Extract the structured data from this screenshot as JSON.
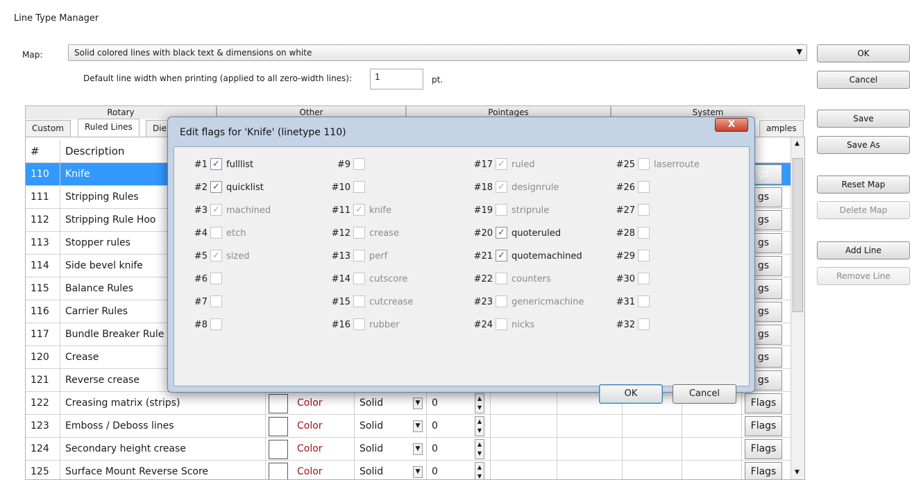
{
  "window": {
    "title": "Line Type Manager"
  },
  "map": {
    "label": "Map:",
    "value": "Solid colored lines with black text & dimensions on white",
    "default_width_label": "Default line width when printing (applied to all zero-width lines):",
    "default_width_value": "1",
    "unit": "pt."
  },
  "side_buttons": {
    "ok": "OK",
    "cancel": "Cancel",
    "save": "Save",
    "save_as": "Save As",
    "reset_map": "Reset Map",
    "delete_map": "Delete Map",
    "add_line": "Add Line",
    "remove_line": "Remove Line"
  },
  "group_tabs": [
    "Rotary",
    "Other",
    "Pointages",
    "System"
  ],
  "sub_tabs": {
    "custom": "Custom",
    "ruled": "Ruled Lines",
    "die": "Die",
    "samples": "amples"
  },
  "table": {
    "headers": {
      "num": "#",
      "desc": "Description",
      "flags": "gs"
    },
    "rows": [
      {
        "num": "110",
        "desc": "Knife",
        "flags": "gs"
      },
      {
        "num": "111",
        "desc": "Stripping Rules",
        "flags": "gs"
      },
      {
        "num": "112",
        "desc": "Stripping Rule Hoo",
        "flags": "gs"
      },
      {
        "num": "113",
        "desc": "Stopper rules",
        "flags": "gs"
      },
      {
        "num": "114",
        "desc": "Side bevel knife",
        "flags": "gs"
      },
      {
        "num": "115",
        "desc": "Balance Rules",
        "flags": "gs"
      },
      {
        "num": "116",
        "desc": "Carrier Rules",
        "flags": "gs"
      },
      {
        "num": "117",
        "desc": "Bundle Breaker Rule",
        "flags": "gs"
      },
      {
        "num": "120",
        "desc": "Crease",
        "flags": "gs"
      },
      {
        "num": "121",
        "desc": "Reverse crease",
        "flags": "gs"
      },
      {
        "num": "122",
        "desc": "Creasing matrix (strips)",
        "color": "Color",
        "style": "Solid",
        "width": "0",
        "flags": "Flags"
      },
      {
        "num": "123",
        "desc": "Emboss / Deboss lines",
        "color": "Color",
        "style": "Solid",
        "width": "0",
        "flags": "Flags"
      },
      {
        "num": "124",
        "desc": "Secondary height crease",
        "color": "Color",
        "style": "Solid",
        "width": "0",
        "flags": "Flags"
      },
      {
        "num": "125",
        "desc": "Surface Mount Reverse Score",
        "color": "Color",
        "style": "Solid",
        "width": "0",
        "flags": "Flags"
      }
    ]
  },
  "dialog": {
    "title": "Edit flags for 'Knife' (linetype 110)",
    "close": "X",
    "ok": "OK",
    "cancel": "Cancel",
    "flags": [
      {
        "num": "#1",
        "label": "fulllist",
        "checked": true,
        "enabled": true
      },
      {
        "num": "#2",
        "label": "quicklist",
        "checked": true,
        "enabled": true
      },
      {
        "num": "#3",
        "label": "machined",
        "checked": true,
        "enabled": false
      },
      {
        "num": "#4",
        "label": "etch",
        "checked": false,
        "enabled": false
      },
      {
        "num": "#5",
        "label": "sized",
        "checked": true,
        "enabled": false
      },
      {
        "num": "#6",
        "label": "",
        "checked": false,
        "enabled": false
      },
      {
        "num": "#7",
        "label": "",
        "checked": false,
        "enabled": false
      },
      {
        "num": "#8",
        "label": "",
        "checked": false,
        "enabled": false
      },
      {
        "num": "#9",
        "label": "",
        "checked": false,
        "enabled": false
      },
      {
        "num": "#10",
        "label": "",
        "checked": false,
        "enabled": false
      },
      {
        "num": "#11",
        "label": "knife",
        "checked": true,
        "enabled": false
      },
      {
        "num": "#12",
        "label": "crease",
        "checked": false,
        "enabled": false
      },
      {
        "num": "#13",
        "label": "perf",
        "checked": false,
        "enabled": false
      },
      {
        "num": "#14",
        "label": "cutscore",
        "checked": false,
        "enabled": false
      },
      {
        "num": "#15",
        "label": "cutcrease",
        "checked": false,
        "enabled": false
      },
      {
        "num": "#16",
        "label": "rubber",
        "checked": false,
        "enabled": false
      },
      {
        "num": "#17",
        "label": "ruled",
        "checked": true,
        "enabled": false
      },
      {
        "num": "#18",
        "label": "designrule",
        "checked": true,
        "enabled": false
      },
      {
        "num": "#19",
        "label": "striprule",
        "checked": false,
        "enabled": false
      },
      {
        "num": "#20",
        "label": "quoteruled",
        "checked": true,
        "enabled": true
      },
      {
        "num": "#21",
        "label": "quotemachined",
        "checked": true,
        "enabled": true
      },
      {
        "num": "#22",
        "label": "counters",
        "checked": false,
        "enabled": false
      },
      {
        "num": "#23",
        "label": "genericmachine",
        "checked": false,
        "enabled": false
      },
      {
        "num": "#24",
        "label": "nicks",
        "checked": false,
        "enabled": false
      },
      {
        "num": "#25",
        "label": "laserroute",
        "checked": false,
        "enabled": false
      },
      {
        "num": "#26",
        "label": "",
        "checked": false,
        "enabled": false
      },
      {
        "num": "#27",
        "label": "",
        "checked": false,
        "enabled": false
      },
      {
        "num": "#28",
        "label": "",
        "checked": false,
        "enabled": false
      },
      {
        "num": "#29",
        "label": "",
        "checked": false,
        "enabled": false
      },
      {
        "num": "#30",
        "label": "",
        "checked": false,
        "enabled": false
      },
      {
        "num": "#31",
        "label": "",
        "checked": false,
        "enabled": false
      },
      {
        "num": "#32",
        "label": "",
        "checked": false,
        "enabled": false
      }
    ]
  }
}
